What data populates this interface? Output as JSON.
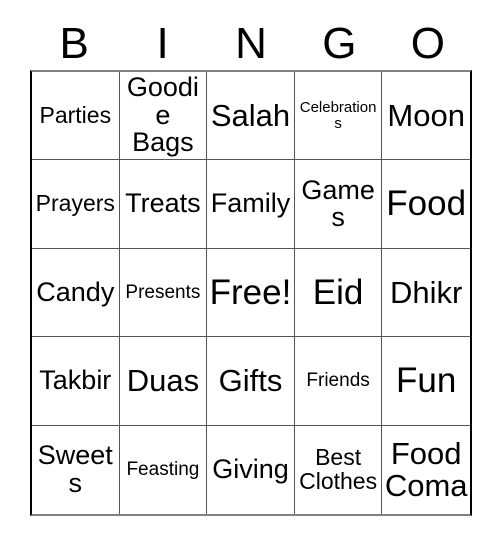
{
  "card": {
    "title": "BINGO",
    "header_letters": [
      "B",
      "I",
      "N",
      "G",
      "O"
    ],
    "free_space_label": "Free!",
    "colors": {
      "background": "#ffffff",
      "text": "#000000",
      "grid_line": "#555555",
      "outer_border": "#000000"
    },
    "grid": {
      "columns": 5,
      "rows": 5,
      "cells": [
        {
          "text": "Parties",
          "size": "m"
        },
        {
          "text": "Goodie\nBags",
          "size": "l"
        },
        {
          "text": "Salah",
          "size": "xl"
        },
        {
          "text": "Celebrations",
          "size": "xs"
        },
        {
          "text": "Moon",
          "size": "xl"
        },
        {
          "text": "Prayers",
          "size": "m"
        },
        {
          "text": "Treats",
          "size": "l"
        },
        {
          "text": "Family",
          "size": "l"
        },
        {
          "text": "Games",
          "size": "l"
        },
        {
          "text": "Food",
          "size": "xxl"
        },
        {
          "text": "Candy",
          "size": "l"
        },
        {
          "text": "Presents",
          "size": "s"
        },
        {
          "text": "Free!",
          "size": "xxl"
        },
        {
          "text": "Eid",
          "size": "xxl"
        },
        {
          "text": "Dhikr",
          "size": "xl"
        },
        {
          "text": "Takbir",
          "size": "l"
        },
        {
          "text": "Duas",
          "size": "xl"
        },
        {
          "text": "Gifts",
          "size": "xl"
        },
        {
          "text": "Friends",
          "size": "s"
        },
        {
          "text": "Fun",
          "size": "xxl"
        },
        {
          "text": "Sweets",
          "size": "l"
        },
        {
          "text": "Feasting",
          "size": "s"
        },
        {
          "text": "Giving",
          "size": "l"
        },
        {
          "text": "Best\nClothes",
          "size": "m"
        },
        {
          "text": "Food\nComa",
          "size": "xl"
        }
      ]
    }
  }
}
